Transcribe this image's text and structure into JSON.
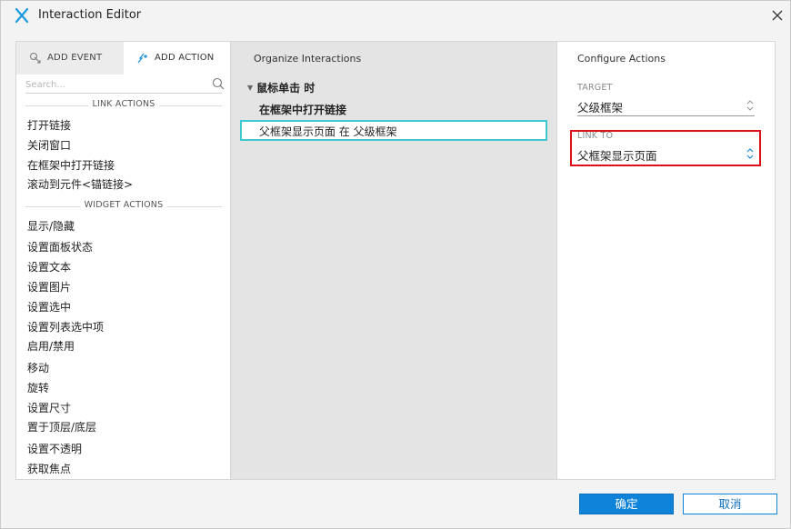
{
  "window": {
    "title": "Interaction Editor",
    "accent": "#0f82d9"
  },
  "left": {
    "tabs": [
      {
        "label": "ADD EVENT",
        "icon": "add-event-icon",
        "active": false
      },
      {
        "label": "ADD ACTION",
        "icon": "add-action-icon",
        "active": true
      }
    ],
    "search_placeholder": "Search...",
    "sections": [
      {
        "header": "LINK ACTIONS",
        "items": [
          "打开链接",
          "关闭窗口",
          "在框架中打开链接",
          "滚动到元件<锚链接>"
        ]
      },
      {
        "header": "WIDGET ACTIONS",
        "items": [
          "显示/隐藏",
          "设置面板状态",
          "设置文本",
          "设置图片",
          "设置选中",
          "设置列表选中项",
          "启用/禁用",
          "移动",
          "旋转",
          "设置尺寸",
          "置于顶层/底层",
          "设置不透明",
          "获取焦点"
        ]
      }
    ]
  },
  "middle": {
    "title": "Organize Interactions",
    "event": "鼠标单击 时",
    "case": "在框架中打开链接",
    "action": "父框架显示页面 在 父级框架",
    "selection_color": "#3ec8cf"
  },
  "right": {
    "title": "Configure Actions",
    "target_label": "TARGET",
    "target_value": "父级框架",
    "link_label": "LINK TO",
    "link_value": "父框架显示页面",
    "highlight_color": "#e0101a"
  },
  "footer": {
    "ok_label": "确定",
    "cancel_label": "取消"
  }
}
